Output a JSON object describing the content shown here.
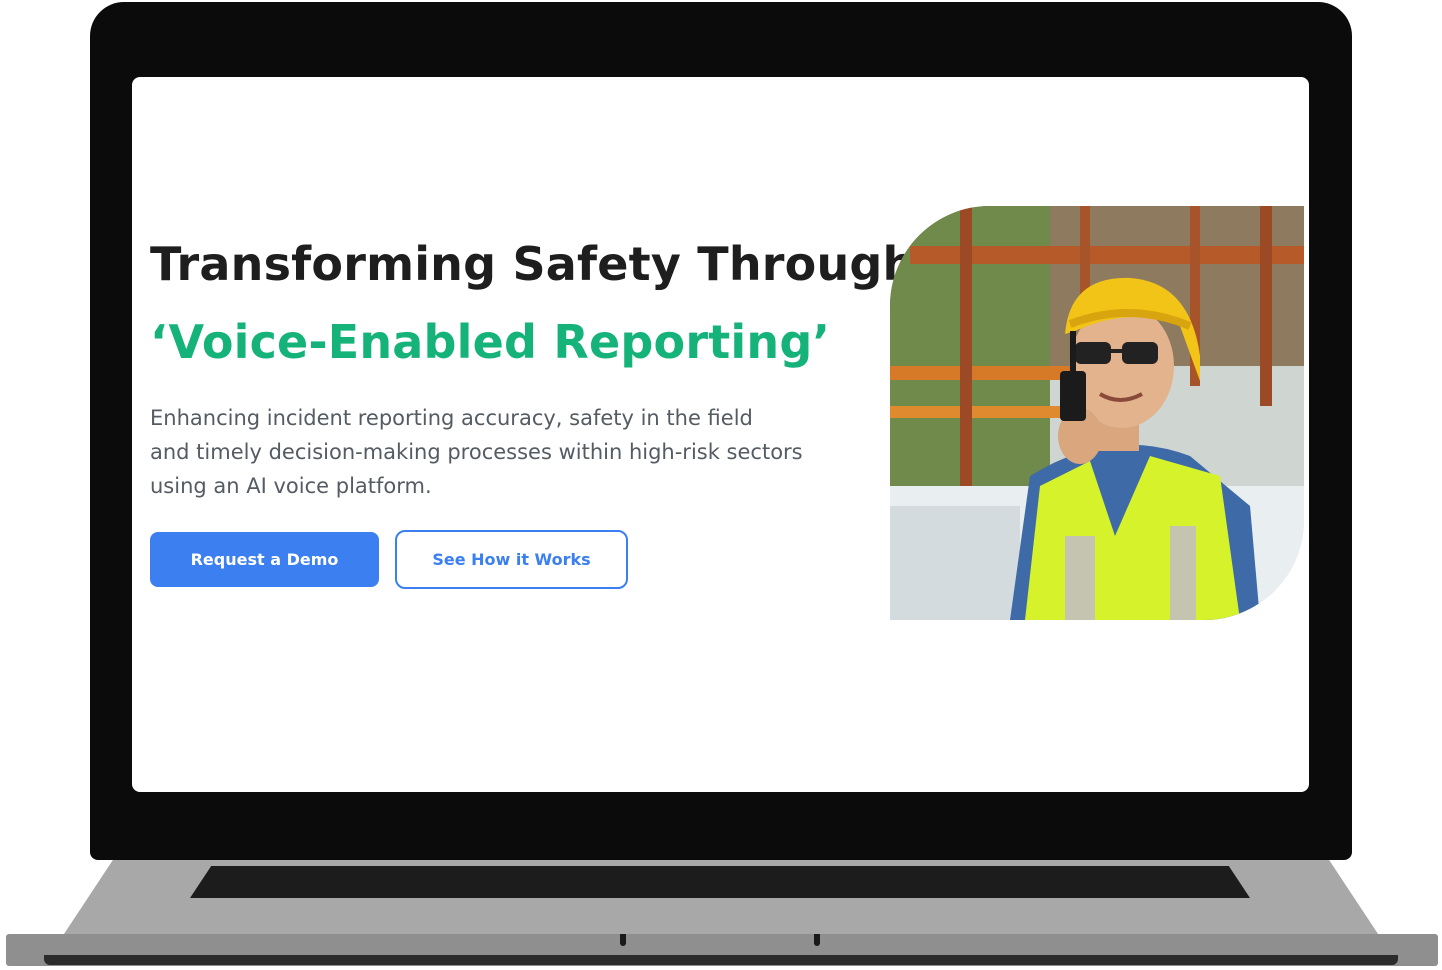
{
  "hero": {
    "title_line1": "Transforming Safety Through",
    "title_line2": "‘Voice-Enabled Reporting’",
    "subtitle_line1": "Enhancing incident reporting accuracy, safety in the field",
    "subtitle_line2": "and timely decision-making processes within high-risk sectors",
    "subtitle_line3": "using an AI voice platform.",
    "image_alt": "Construction worker in hard hat and safety vest speaking into a two-way radio"
  },
  "buttons": {
    "primary_label": "Request a Demo",
    "secondary_label": "See How it Works"
  },
  "colors": {
    "accent_green": "#15b27a",
    "primary_blue": "#3b7ff0",
    "heading": "#1e1e1e",
    "body_text": "#555b63"
  }
}
